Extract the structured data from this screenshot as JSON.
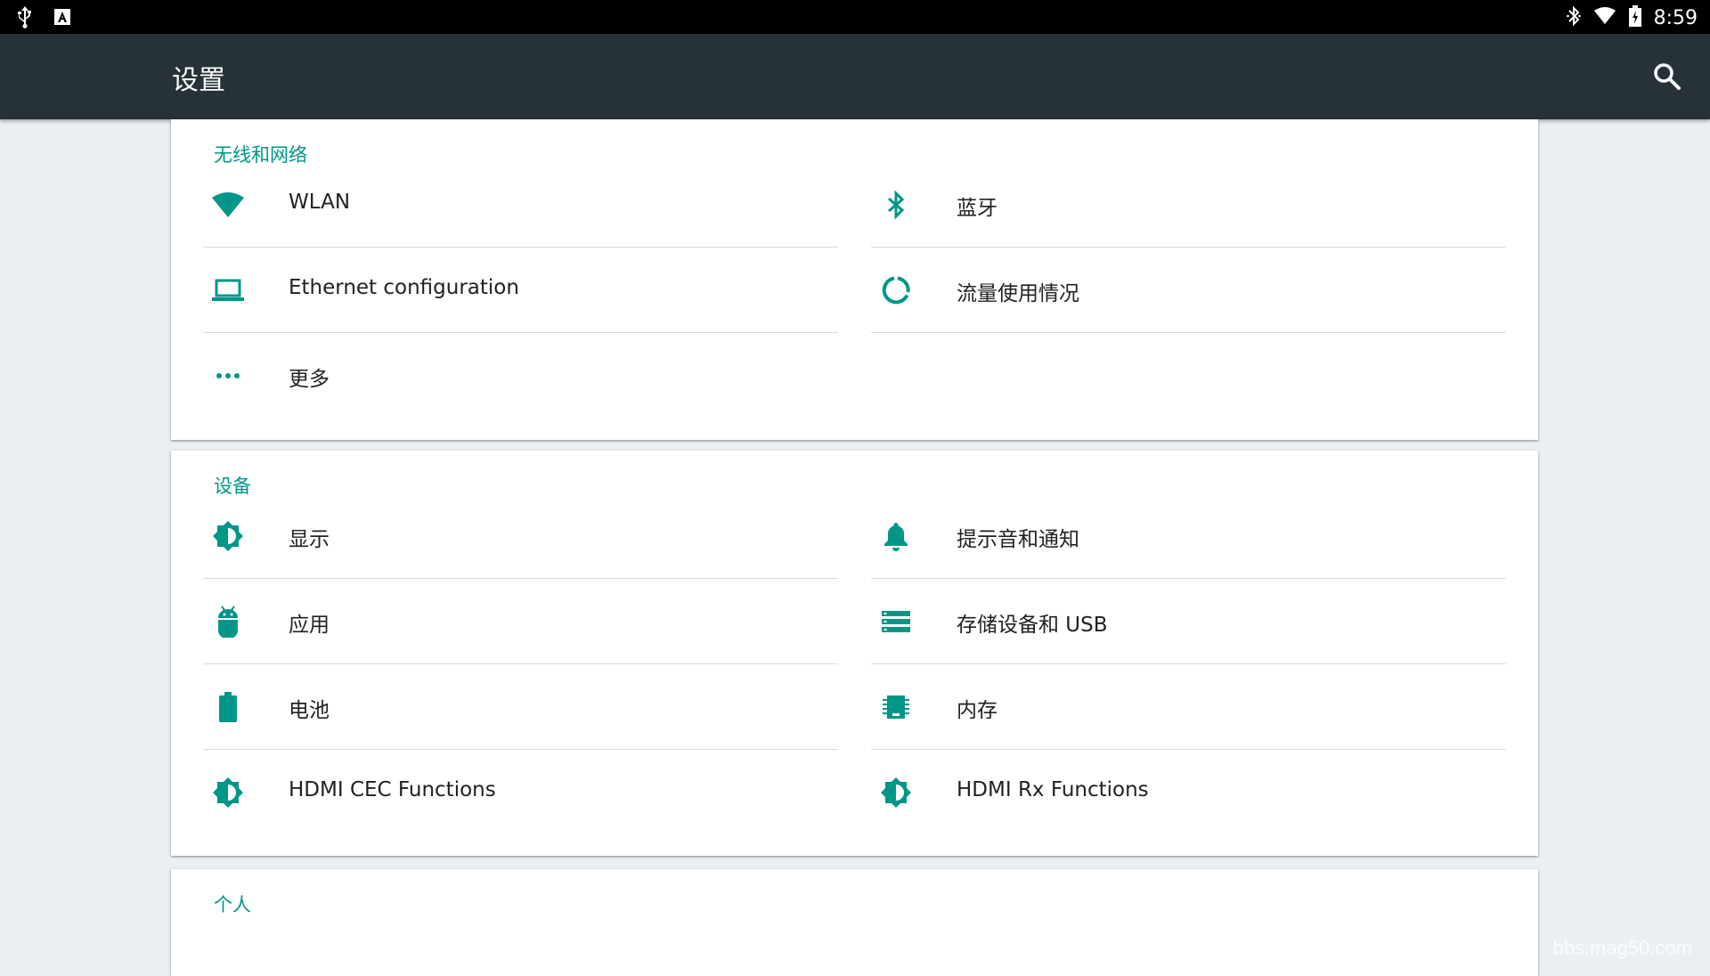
{
  "status_bar": {
    "time": "8:59",
    "left_icons": [
      "usb-icon",
      "a-notification-icon"
    ],
    "right_icons": [
      "bluetooth-icon",
      "wifi-icon",
      "battery-icon"
    ]
  },
  "app_bar": {
    "title": "设置",
    "search_icon": "search-icon"
  },
  "sections": [
    {
      "title": "无线和网络",
      "items": [
        {
          "label": "WLAN",
          "icon": "wifi-icon"
        },
        {
          "label": "蓝牙",
          "icon": "bluetooth-icon"
        },
        {
          "label": "Ethernet configuration",
          "icon": "laptop-icon"
        },
        {
          "label": "流量使用情况",
          "icon": "data-usage-icon"
        },
        {
          "label": "更多",
          "icon": "more-icon"
        }
      ]
    },
    {
      "title": "设备",
      "items": [
        {
          "label": "显示",
          "icon": "brightness-icon"
        },
        {
          "label": "提示音和通知",
          "icon": "bell-icon"
        },
        {
          "label": "应用",
          "icon": "android-icon"
        },
        {
          "label": "存储设备和 USB",
          "icon": "storage-icon"
        },
        {
          "label": "电池",
          "icon": "battery-icon"
        },
        {
          "label": "内存",
          "icon": "memory-icon"
        },
        {
          "label": "HDMI CEC Functions",
          "icon": "brightness-icon"
        },
        {
          "label": "HDMI Rx Functions",
          "icon": "brightness-icon"
        }
      ]
    },
    {
      "title": "个人",
      "items": []
    }
  ],
  "watermark": "bbs.mag50.com",
  "colors": {
    "accent": "#009688",
    "app_bar": "#263238",
    "status_bar": "#000000",
    "background": "#eceff1"
  }
}
